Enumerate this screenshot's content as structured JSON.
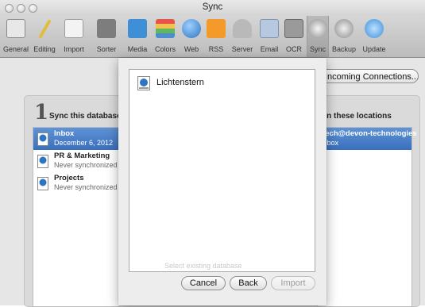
{
  "window": {
    "title": "Sync"
  },
  "toolbar": {
    "items": [
      {
        "label": "General",
        "icon": "general-icon",
        "color": "#c8c8c8"
      },
      {
        "label": "Editing",
        "icon": "pencil-icon",
        "color": "#e2c44f"
      },
      {
        "label": "Import",
        "icon": "import-icon",
        "color": "#d9d9d9"
      },
      {
        "label": "Sorter",
        "icon": "sorter-icon",
        "color": "#8e8e8e"
      },
      {
        "label": "Media",
        "icon": "media-icon",
        "color": "#3f8fd6"
      },
      {
        "label": "Colors",
        "icon": "colors-icon",
        "color": "#62b65b"
      },
      {
        "label": "Web",
        "icon": "globe-icon",
        "color": "#4b8fd0"
      },
      {
        "label": "RSS",
        "icon": "rss-icon",
        "color": "#f49a2a"
      },
      {
        "label": "Server",
        "icon": "server-icon",
        "color": "#a4a4a4"
      },
      {
        "label": "Email",
        "icon": "email-icon",
        "color": "#9db5d4"
      },
      {
        "label": "OCR",
        "icon": "ocr-icon",
        "color": "#8a8a8a"
      },
      {
        "label": "Sync",
        "icon": "sync-icon",
        "color": "#8a8a8a"
      },
      {
        "label": "Backup",
        "icon": "backup-icon",
        "color": "#8a8a8a"
      },
      {
        "label": "Update",
        "icon": "update-icon",
        "color": "#3d8fd8"
      }
    ]
  },
  "sync": {
    "incoming_button": "Incoming Connections...",
    "step_number": "1",
    "step_text": "Sync this database...",
    "locations_header": "...in these locations",
    "databases": [
      {
        "name": "Inbox",
        "status": "December 6, 2012"
      },
      {
        "name": "PR & Marketing",
        "status": "Never synchronized"
      },
      {
        "name": "Projects",
        "status": "Never synchronized"
      }
    ],
    "locations": [
      {
        "name": "jlech@devon-technologies",
        "detail": "Inbox"
      }
    ]
  },
  "sheet": {
    "files": [
      {
        "name": "Lichtenstern",
        "icon": "database-icon"
      }
    ],
    "ghost_text": "Select existing database",
    "buttons": {
      "cancel": "Cancel",
      "back": "Back",
      "import": "Import"
    }
  }
}
